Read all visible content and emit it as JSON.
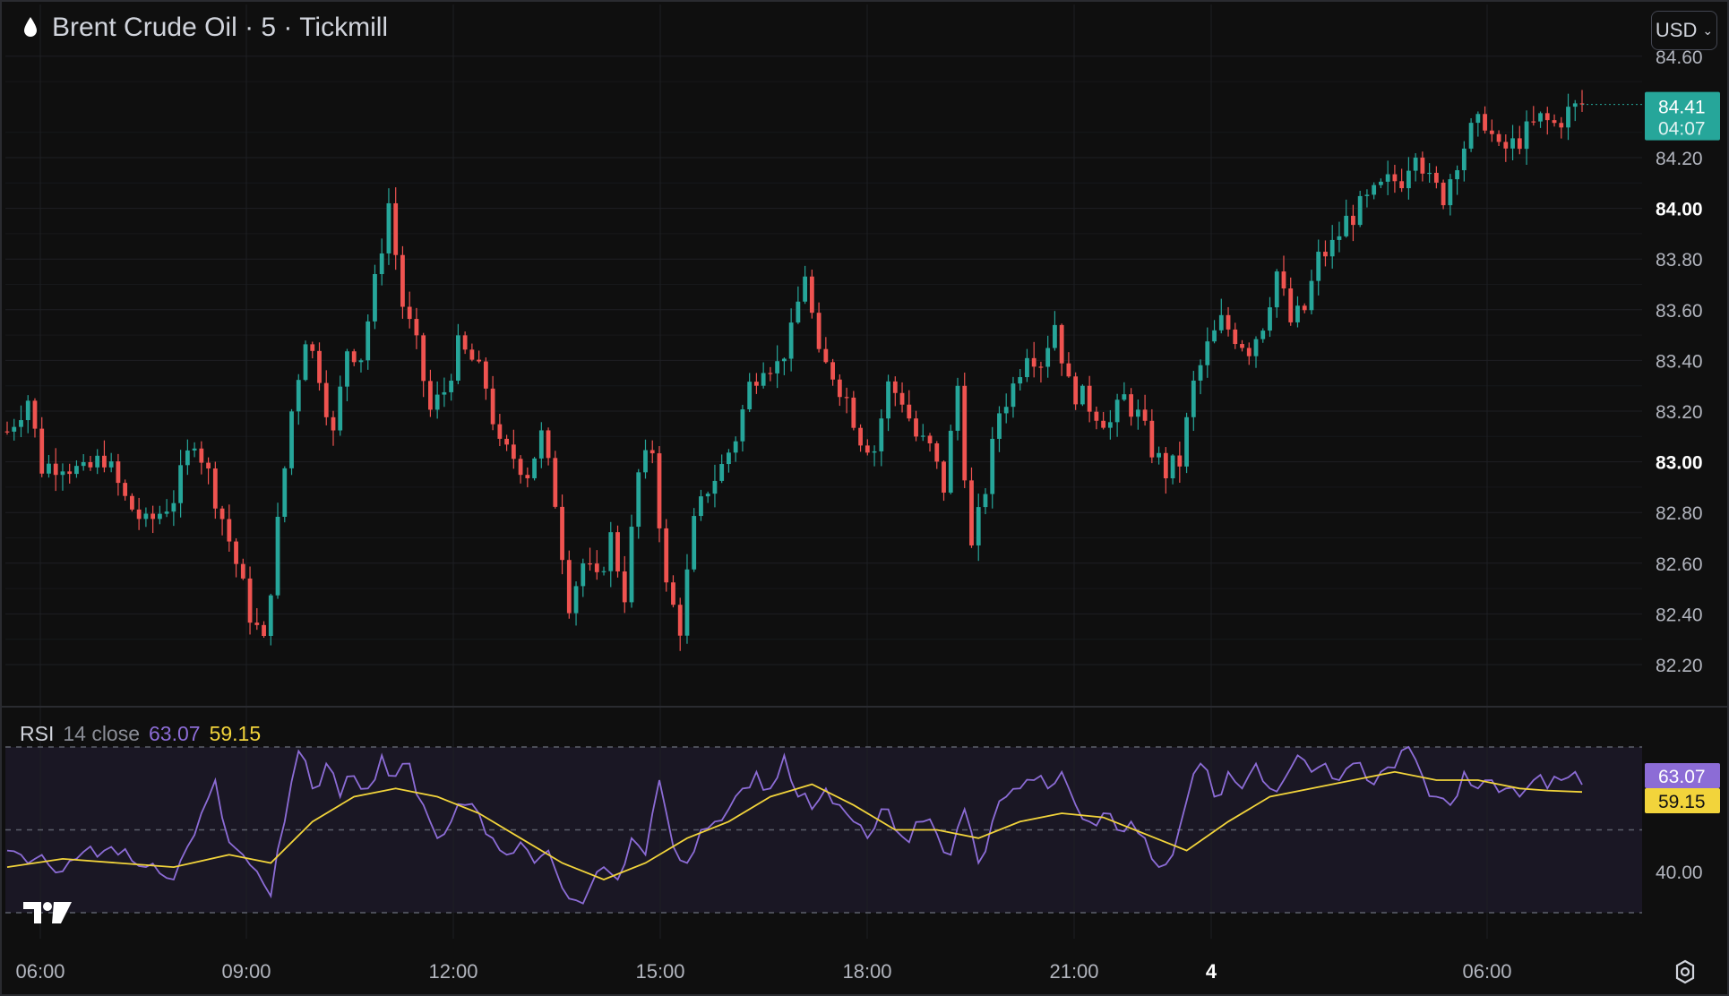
{
  "header": {
    "title": "Brent Crude Oil · 5 · Tickmill",
    "currency": "USD",
    "icon": "drop-icon"
  },
  "price_scale": {
    "current_price": "84.41",
    "countdown": "04:07",
    "current_color": "#26a69a"
  },
  "rsi_pane": {
    "name": "RSI",
    "params": "14 close",
    "rsi_value": "63.07",
    "ma_value": "59.15",
    "rsi_color": "#8c6cd6",
    "ma_color": "#f2d43b"
  },
  "colors": {
    "up": "#26a69a",
    "down": "#ef5350",
    "background": "#0f0f0f",
    "grid": "#1e1f23"
  },
  "chart_data": [
    {
      "type": "candlestick",
      "title": "Brent Crude Oil · 5 · Tickmill",
      "xlabel": "",
      "ylabel": "",
      "ylim": [
        82.1,
        84.67
      ],
      "x_ticks": [
        "06:00",
        "09:00",
        "12:00",
        "15:00",
        "18:00",
        "21:00",
        "4",
        "06:00"
      ],
      "y_ticks": [
        "82.20",
        "82.40",
        "82.60",
        "82.80",
        "83.00",
        "83.20",
        "83.40",
        "83.60",
        "83.80",
        "84.00",
        "84.20",
        "84.60"
      ],
      "bold_y_ticks": [
        "83.00",
        "84.00"
      ],
      "x_span": [
        "05:45",
        "07:50 (day 4)"
      ],
      "close_path": [
        [
          0,
          83.12
        ],
        [
          3,
          83.25
        ],
        [
          5,
          82.98
        ],
        [
          8,
          83.0
        ],
        [
          11,
          82.95
        ],
        [
          14,
          83.02
        ],
        [
          17,
          82.85
        ],
        [
          20,
          82.75
        ],
        [
          22,
          82.8
        ],
        [
          24,
          82.86
        ],
        [
          27,
          83.1
        ],
        [
          29,
          82.95
        ],
        [
          31,
          82.78
        ],
        [
          33,
          82.6
        ],
        [
          35,
          82.4
        ],
        [
          37,
          82.28
        ],
        [
          39,
          82.75
        ],
        [
          41,
          83.2
        ],
        [
          43,
          83.5
        ],
        [
          45,
          83.35
        ],
        [
          47,
          83.1
        ],
        [
          49,
          83.45
        ],
        [
          51,
          83.42
        ],
        [
          53,
          83.7
        ],
        [
          55,
          84.02
        ],
        [
          57,
          83.62
        ],
        [
          59,
          83.45
        ],
        [
          61,
          83.2
        ],
        [
          63,
          83.28
        ],
        [
          65,
          83.45
        ],
        [
          67,
          83.4
        ],
        [
          69,
          83.3
        ],
        [
          71,
          83.05
        ],
        [
          73,
          83.02
        ],
        [
          75,
          82.96
        ],
        [
          77,
          83.1
        ],
        [
          79,
          82.85
        ],
        [
          81,
          82.45
        ],
        [
          83,
          82.6
        ],
        [
          85,
          82.52
        ],
        [
          87,
          82.7
        ],
        [
          89,
          82.48
        ],
        [
          91,
          82.95
        ],
        [
          93,
          83.05
        ],
        [
          95,
          82.5
        ],
        [
          97,
          82.35
        ],
        [
          99,
          82.75
        ],
        [
          101,
          82.9
        ],
        [
          103,
          82.98
        ],
        [
          105,
          83.1
        ],
        [
          107,
          83.3
        ],
        [
          109,
          83.4
        ],
        [
          111,
          83.38
        ],
        [
          113,
          83.5
        ],
        [
          115,
          83.75
        ],
        [
          117,
          83.4
        ],
        [
          119,
          83.35
        ],
        [
          121,
          83.25
        ],
        [
          123,
          83.1
        ],
        [
          125,
          83.05
        ],
        [
          127,
          83.3
        ],
        [
          129,
          83.25
        ],
        [
          131,
          83.1
        ],
        [
          133,
          83.05
        ],
        [
          135,
          82.9
        ],
        [
          137,
          83.3
        ],
        [
          139,
          82.65
        ],
        [
          141,
          82.9
        ],
        [
          143,
          83.2
        ],
        [
          145,
          83.3
        ],
        [
          147,
          83.45
        ],
        [
          149,
          83.4
        ],
        [
          151,
          83.55
        ],
        [
          153,
          83.3
        ],
        [
          155,
          83.25
        ],
        [
          157,
          83.2
        ],
        [
          159,
          83.15
        ],
        [
          161,
          83.25
        ],
        [
          163,
          83.18
        ],
        [
          165,
          83.05
        ],
        [
          167,
          82.96
        ],
        [
          169,
          83.0
        ],
        [
          171,
          83.3
        ],
        [
          173,
          83.45
        ],
        [
          175,
          83.55
        ],
        [
          177,
          83.5
        ],
        [
          179,
          83.45
        ],
        [
          181,
          83.55
        ],
        [
          183,
          83.75
        ],
        [
          185,
          83.55
        ],
        [
          187,
          83.6
        ],
        [
          189,
          83.8
        ],
        [
          191,
          83.85
        ],
        [
          193,
          83.95
        ],
        [
          195,
          84.0
        ],
        [
          197,
          84.05
        ],
        [
          199,
          84.1
        ],
        [
          201,
          84.12
        ],
        [
          203,
          84.25
        ],
        [
          205,
          84.1
        ],
        [
          207,
          84.05
        ],
        [
          209,
          84.2
        ],
        [
          211,
          84.3
        ],
        [
          213,
          84.35
        ],
        [
          215,
          84.22
        ],
        [
          217,
          84.25
        ],
        [
          219,
          84.3
        ],
        [
          221,
          84.35
        ],
        [
          223,
          84.33
        ],
        [
          225,
          84.38
        ],
        [
          227,
          84.41
        ]
      ],
      "candle_count": 228,
      "current_price": 84.41
    },
    {
      "type": "line",
      "title": "RSI 14 close",
      "ylim": [
        30,
        70
      ],
      "y_ticks": [
        "40.00"
      ],
      "bands": [
        30,
        50,
        70
      ],
      "series": [
        {
          "name": "RSI",
          "color": "#8c6cd6",
          "path": [
            [
              0,
              45
            ],
            [
              4,
              43
            ],
            [
              8,
              40
            ],
            [
              12,
              46
            ],
            [
              16,
              44
            ],
            [
              20,
              41
            ],
            [
              24,
              38
            ],
            [
              28,
              54
            ],
            [
              30,
              62
            ],
            [
              32,
              47
            ],
            [
              34,
              44
            ],
            [
              36,
              40
            ],
            [
              38,
              34
            ],
            [
              40,
              52
            ],
            [
              42,
              69
            ],
            [
              44,
              60
            ],
            [
              46,
              66
            ],
            [
              48,
              58
            ],
            [
              50,
              63
            ],
            [
              52,
              60
            ],
            [
              54,
              68
            ],
            [
              56,
              63
            ],
            [
              58,
              66
            ],
            [
              60,
              56
            ],
            [
              62,
              48
            ],
            [
              64,
              52
            ],
            [
              66,
              56
            ],
            [
              68,
              54
            ],
            [
              70,
              48
            ],
            [
              72,
              44
            ],
            [
              74,
              47
            ],
            [
              76,
              42
            ],
            [
              78,
              45
            ],
            [
              80,
              36
            ],
            [
              82,
              33
            ],
            [
              84,
              36
            ],
            [
              86,
              41
            ],
            [
              88,
              38
            ],
            [
              90,
              48
            ],
            [
              92,
              44
            ],
            [
              94,
              62
            ],
            [
              96,
              46
            ],
            [
              98,
              42
            ],
            [
              100,
              50
            ],
            [
              102,
              52
            ],
            [
              104,
              55
            ],
            [
              106,
              60
            ],
            [
              108,
              64
            ],
            [
              110,
              60
            ],
            [
              112,
              68
            ],
            [
              114,
              58
            ],
            [
              116,
              55
            ],
            [
              118,
              60
            ],
            [
              120,
              56
            ],
            [
              122,
              52
            ],
            [
              124,
              48
            ],
            [
              126,
              55
            ],
            [
              128,
              50
            ],
            [
              130,
              47
            ],
            [
              132,
              52
            ],
            [
              134,
              49
            ],
            [
              136,
              44
            ],
            [
              138,
              55
            ],
            [
              140,
              42
            ],
            [
              142,
              52
            ],
            [
              144,
              58
            ],
            [
              146,
              60
            ],
            [
              148,
              62
            ],
            [
              150,
              60
            ],
            [
              152,
              64
            ],
            [
              154,
              56
            ],
            [
              156,
              52
            ],
            [
              158,
              54
            ],
            [
              160,
              50
            ],
            [
              162,
              52
            ],
            [
              164,
              48
            ],
            [
              166,
              41
            ],
            [
              168,
              44
            ],
            [
              170,
              57
            ],
            [
              172,
              66
            ],
            [
              174,
              58
            ],
            [
              176,
              64
            ],
            [
              178,
              60
            ],
            [
              180,
              66
            ],
            [
              182,
              60
            ],
            [
              184,
              62
            ],
            [
              186,
              68
            ],
            [
              188,
              64
            ],
            [
              190,
              66
            ],
            [
              192,
              62
            ],
            [
              194,
              66
            ],
            [
              196,
              62
            ],
            [
              198,
              64
            ],
            [
              200,
              65
            ],
            [
              202,
              70
            ],
            [
              204,
              63
            ],
            [
              206,
              58
            ],
            [
              208,
              56
            ],
            [
              210,
              64
            ],
            [
              212,
              60
            ],
            [
              214,
              62
            ],
            [
              216,
              60
            ],
            [
              218,
              58
            ],
            [
              220,
              62
            ],
            [
              222,
              60
            ],
            [
              224,
              62
            ],
            [
              226,
              64
            ],
            [
              227,
              63.07
            ]
          ]
        },
        {
          "name": "RSI-based MA",
          "color": "#f2d43b",
          "path": [
            [
              0,
              41
            ],
            [
              8,
              43
            ],
            [
              16,
              42
            ],
            [
              24,
              41
            ],
            [
              32,
              44
            ],
            [
              38,
              42
            ],
            [
              44,
              52
            ],
            [
              50,
              58
            ],
            [
              56,
              60
            ],
            [
              62,
              58
            ],
            [
              68,
              54
            ],
            [
              74,
              48
            ],
            [
              80,
              42
            ],
            [
              86,
              38
            ],
            [
              92,
              42
            ],
            [
              98,
              48
            ],
            [
              104,
              52
            ],
            [
              110,
              58
            ],
            [
              116,
              61
            ],
            [
              122,
              56
            ],
            [
              128,
              50
            ],
            [
              134,
              50
            ],
            [
              140,
              48
            ],
            [
              146,
              52
            ],
            [
              152,
              54
            ],
            [
              158,
              53
            ],
            [
              164,
              49
            ],
            [
              170,
              45
            ],
            [
              176,
              52
            ],
            [
              182,
              58
            ],
            [
              188,
              60
            ],
            [
              194,
              62
            ],
            [
              200,
              64
            ],
            [
              206,
              62
            ],
            [
              212,
              62
            ],
            [
              218,
              60
            ],
            [
              222,
              59.5
            ],
            [
              227,
              59.15
            ]
          ]
        }
      ]
    }
  ]
}
